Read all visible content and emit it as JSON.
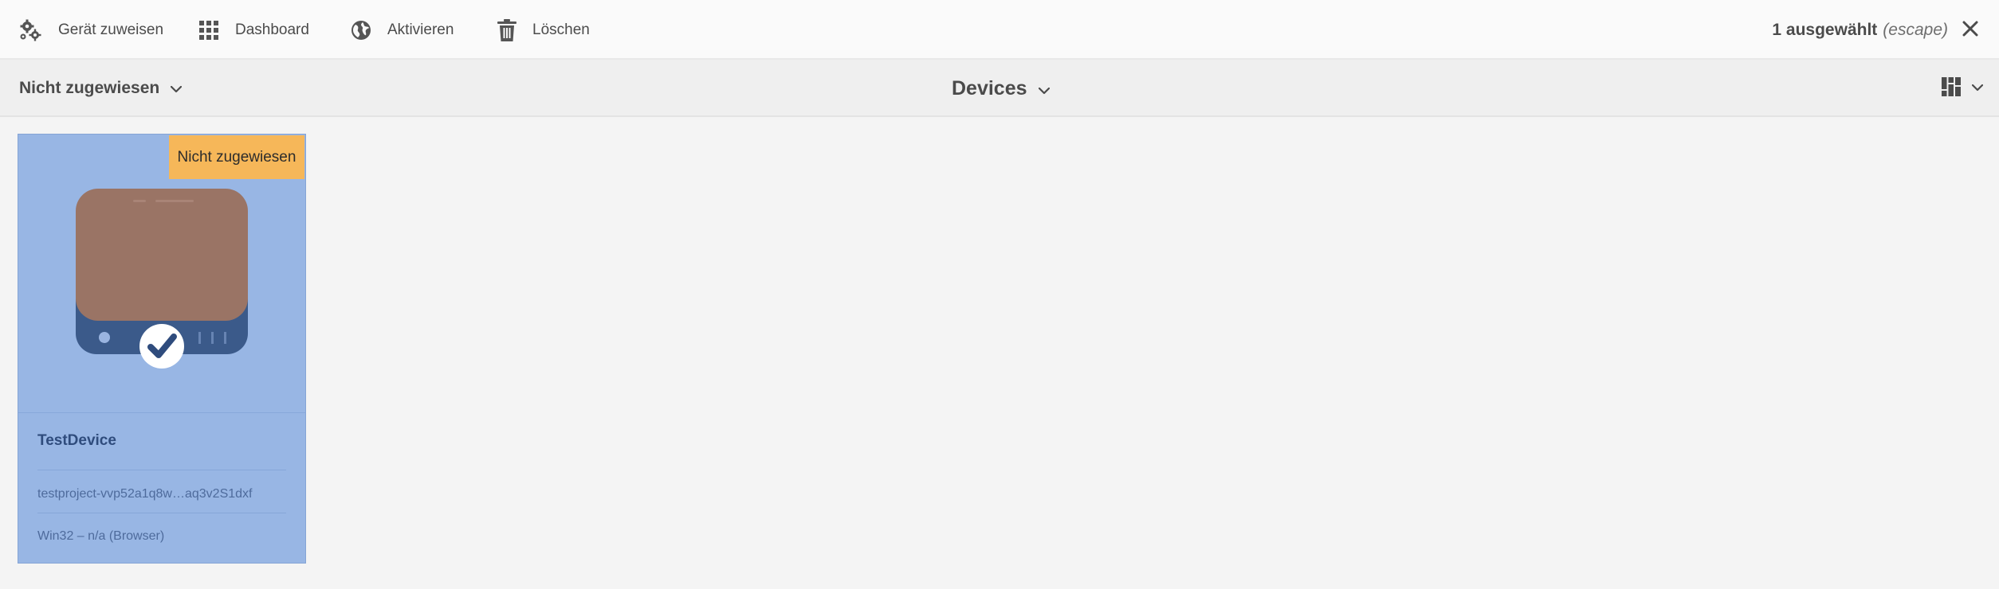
{
  "actionbar": {
    "assign": {
      "label": "Gerät zuweisen",
      "icon": "gears-icon"
    },
    "dashboard": {
      "label": "Dashboard",
      "icon": "grid-icon"
    },
    "activate": {
      "label": "Aktivieren",
      "icon": "globe-icon"
    },
    "delete": {
      "label": "Löschen",
      "icon": "trash-icon"
    },
    "selection_count": "1 ausgewählt",
    "selection_hint": "(escape)"
  },
  "titlebar": {
    "filter_label": "Nicht zugewiesen",
    "title": "Devices"
  },
  "cards": [
    {
      "status": "Nicht zugewiesen",
      "name": "TestDevice",
      "id": "testproject-vvp52a1q8w…aq3v2S1dxf",
      "os": "Win32 – n/a (Browser)",
      "selected": true
    }
  ],
  "colors": {
    "card_selected": "#98b6e4",
    "badge_unassigned": "#f6b759",
    "device_screen": "#9a7465",
    "device_base": "#3b5a8a"
  }
}
